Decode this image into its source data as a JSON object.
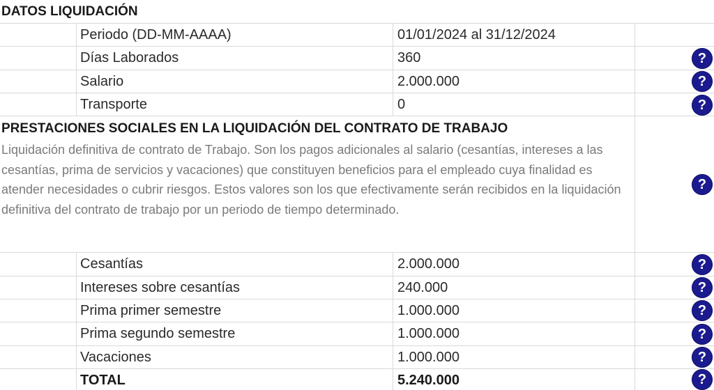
{
  "datos": {
    "title": "DATOS LIQUIDACIÓN",
    "rows": [
      {
        "label": "Periodo (DD-MM-AAAA)",
        "value": "01/01/2024 al 31/12/2024"
      },
      {
        "label": "Días Laborados",
        "value": "360"
      },
      {
        "label": "Salario",
        "value": "2.000.000"
      },
      {
        "label": "Transporte",
        "value": "0"
      }
    ]
  },
  "prestaciones": {
    "title": "PRESTACIONES SOCIALES EN LA LIQUIDACIÓN DEL CONTRATO DE TRABAJO",
    "description": "Liquidación definitiva de contrato de Trabajo. Son los pagos adicionales al salario (cesantías, intereses a las cesantías, prima de servicios y vacaciones) que constituyen beneficios para el empleado cuya finalidad es atender necesidades o cubrir riesgos. Estos valores son los que efectivamente serán recibidos en la liquidación definitiva del contrato de trabajo por un periodo de tiempo determinado.",
    "rows": [
      {
        "label": "Cesantías",
        "value": "2.000.000"
      },
      {
        "label": "Intereses sobre cesantías",
        "value": "240.000"
      },
      {
        "label": "Prima primer semestre",
        "value": "1.000.000"
      },
      {
        "label": "Prima segundo semestre",
        "value": "1.000.000"
      },
      {
        "label": "Vacaciones",
        "value": "1.000.000"
      },
      {
        "label": "TOTAL",
        "value": "5.240.000"
      }
    ]
  },
  "help_glyph": "?",
  "colors": {
    "help_bg": "#1b1b8f",
    "description_text": "#7a7a7a",
    "grid": "#d9d9d9"
  }
}
